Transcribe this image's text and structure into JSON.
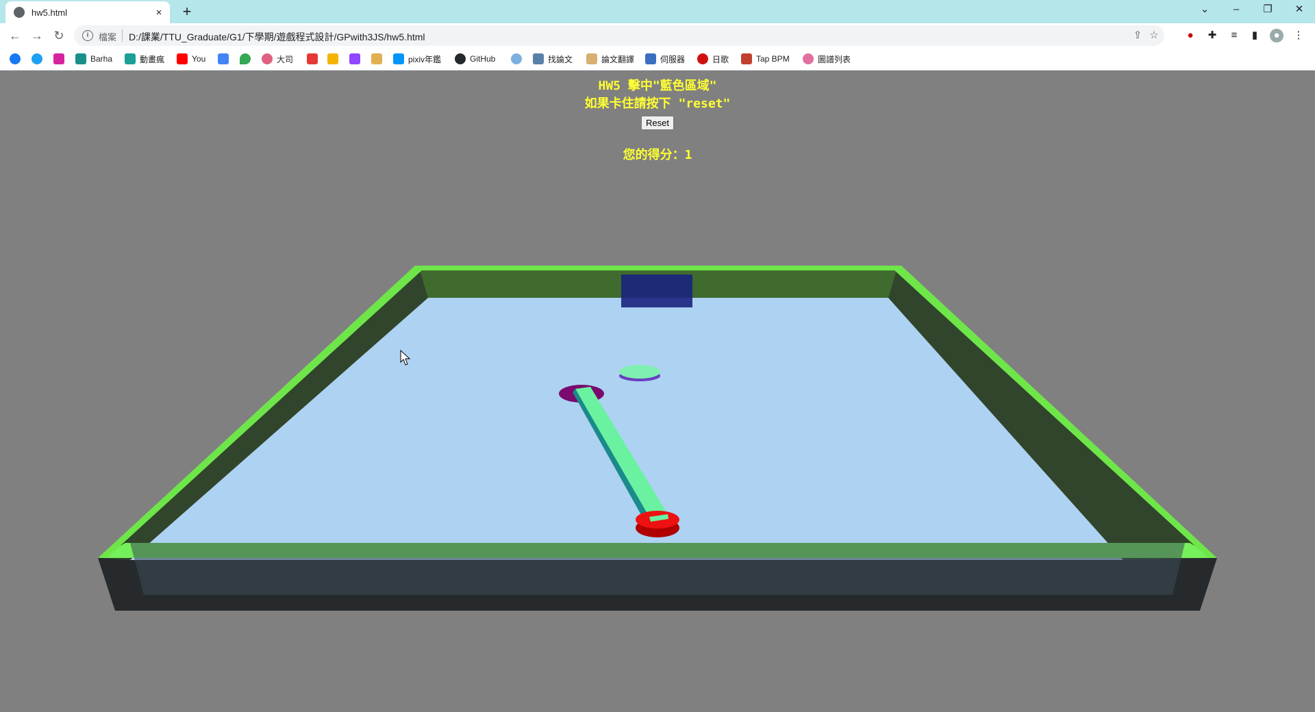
{
  "browser": {
    "tab_title": "hw5.html",
    "tab_close": "×",
    "new_tab": "+",
    "scheme_label": "檔案",
    "url": "D:/課業/TTU_Graduate/G1/下學期/遊戲程式設計/GPwith3JS/hw5.html",
    "bookmarks": [
      "Barha",
      "動畫瘋",
      "You",
      "大司",
      "pixiv年鑑",
      "GitHub",
      "找論文",
      "論文翻譯",
      "伺服器",
      "日歌",
      "Tap BPM",
      "圖譜列表"
    ]
  },
  "hud": {
    "title": "HW5 擊中\"藍色區域\"",
    "hint": "如果卡住請按下 \"reset\"",
    "reset_label": "Reset",
    "score_label": "您的得分：",
    "score_value": "1"
  },
  "colors": {
    "background": "#808080",
    "floor": "#aed2f2",
    "wall_top": "#6ee64a",
    "goal": "#1a237e",
    "puck": "#7ff0b0",
    "hole": "#7a0a6e",
    "stick": "#6af2a0",
    "player": "#ee1111",
    "hud_text": "#ffff33"
  }
}
